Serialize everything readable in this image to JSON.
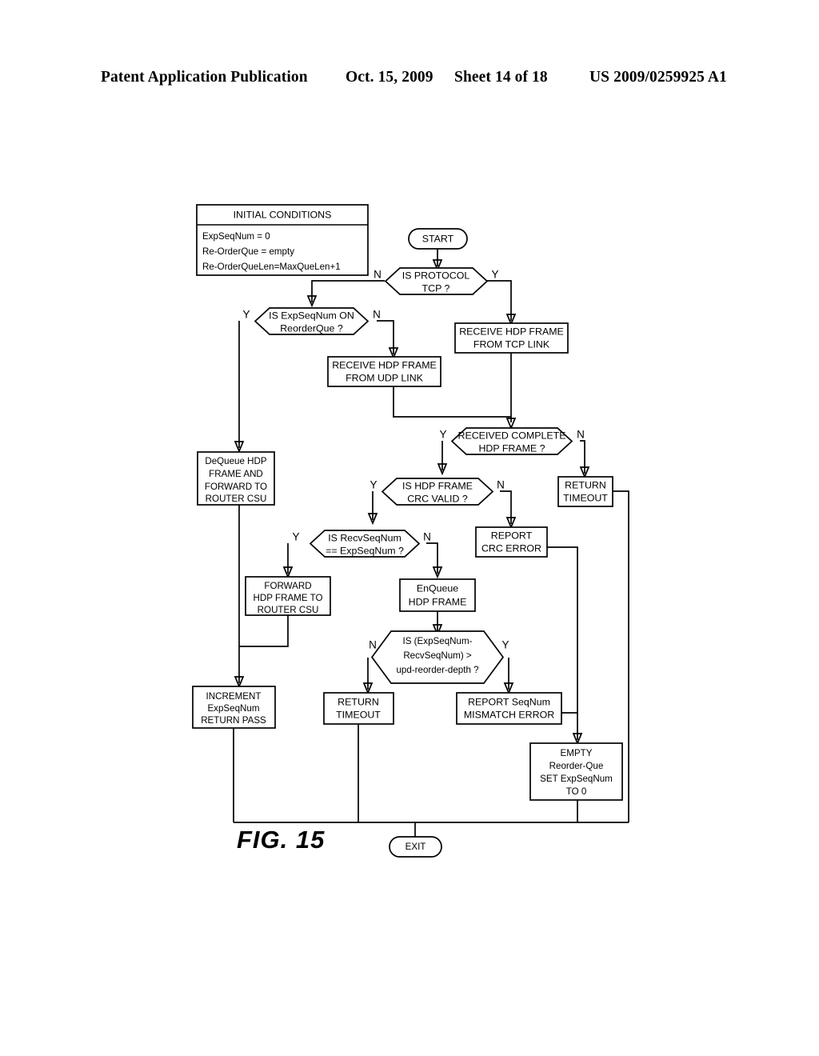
{
  "header": {
    "title": "Patent Application Publication",
    "date": "Oct. 15, 2009",
    "sheet": "Sheet 14 of 18",
    "patent_number": "US 2009/0259925 A1"
  },
  "figure": {
    "label": "FIG. 15"
  },
  "nodes": {
    "initial_conditions": {
      "title": "INITIAL CONDITIONS",
      "line1": "ExpSeqNum = 0",
      "line2": "Re-OrderQue = empty",
      "line3": "Re-OrderQueLen=MaxQueLen+1"
    },
    "start": {
      "label": "START"
    },
    "exit": {
      "label": "EXIT"
    },
    "is_protocol_tcp": {
      "line1": "IS PROTOCOL",
      "line2": "TCP ?",
      "left_branch": "N",
      "right_branch": "Y"
    },
    "is_expseqnum_on_reorderque": {
      "line1": "IS ExpSeqNum ON",
      "line2": "ReorderQue ?",
      "left_branch": "Y",
      "right_branch": "N"
    },
    "receive_tcp": {
      "line1": "RECEIVE HDP FRAME",
      "line2": "FROM TCP LINK"
    },
    "receive_udp": {
      "line1": "RECEIVE HDP FRAME",
      "line2": "FROM UDP LINK"
    },
    "received_complete": {
      "line1": "RECEIVED COMPLETE",
      "line2": "HDP FRAME ?",
      "left_branch": "Y",
      "right_branch": "N"
    },
    "dequeue": {
      "line1": "DeQueue HDP",
      "line2": "FRAME AND",
      "line3": "FORWARD TO",
      "line4": "ROUTER CSU"
    },
    "is_crc_valid": {
      "line1": "IS HDP FRAME",
      "line2": "CRC VALID ?",
      "left_branch": "Y",
      "right_branch": "N"
    },
    "return_timeout_top": {
      "line1": "RETURN",
      "line2": "TIMEOUT"
    },
    "is_recvseqnum_eq": {
      "line1": "IS RecvSeqNum",
      "line2": "== ExpSeqNum ?",
      "left_branch": "Y",
      "right_branch": "N"
    },
    "report_crc_error": {
      "line1": "REPORT",
      "line2": "CRC ERROR"
    },
    "forward_frame": {
      "line1": "FORWARD",
      "line2": "HDP FRAME TO",
      "line3": "ROUTER CSU"
    },
    "enqueue": {
      "line1": "EnQueue",
      "line2": "HDP FRAME"
    },
    "is_reorder_depth": {
      "line1": "IS (ExpSeqNum-",
      "line2": "RecvSeqNum) >",
      "line3": "upd-reorder-depth ?",
      "left_branch": "N",
      "right_branch": "Y"
    },
    "increment": {
      "line1": "INCREMENT",
      "line2": "ExpSeqNum",
      "line3": "RETURN PASS"
    },
    "return_timeout_bottom": {
      "line1": "RETURN",
      "line2": "TIMEOUT"
    },
    "report_seqnum_mismatch": {
      "line1": "REPORT SeqNum",
      "line2": "MISMATCH ERROR"
    },
    "empty_reorder_que": {
      "line1": "EMPTY",
      "line2": "Reorder-Que",
      "line3": "SET ExpSeqNum",
      "line4": "TO 0"
    }
  },
  "colors": {
    "ink": "#000000",
    "paper": "#ffffff"
  }
}
